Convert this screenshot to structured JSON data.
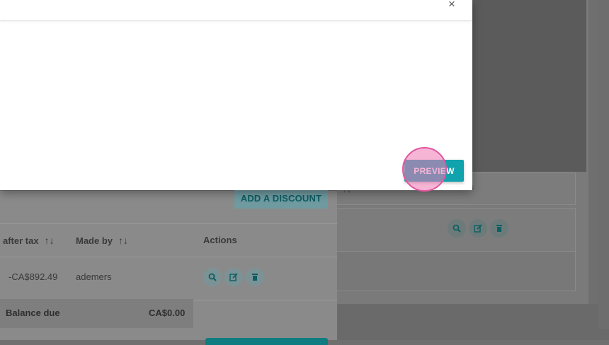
{
  "modal": {
    "close_label": "×",
    "preview_label": "PREVIEW"
  },
  "toolbar": {
    "add_discount_label": "ADD A DISCOUNT"
  },
  "table": {
    "headers": {
      "amount_after_tax": "after tax",
      "made_by": "Made by",
      "actions": "Actions"
    },
    "sort_glyph": "↑↓",
    "rows": [
      {
        "amount": "-CA$892.49",
        "made_by": "ademers"
      }
    ],
    "balance_label": "Balance due",
    "balance_value": "CA$0.00"
  },
  "background_panel": {
    "label_fragment": "s",
    "sort_glyph": "↑↓"
  },
  "icons": {
    "view": "search-icon",
    "edit": "edit-icon",
    "delete": "trash-icon"
  },
  "colors": {
    "accent": "#10a2ad",
    "overlay": "#6f6f6f",
    "click_marker": "#e0559f"
  }
}
